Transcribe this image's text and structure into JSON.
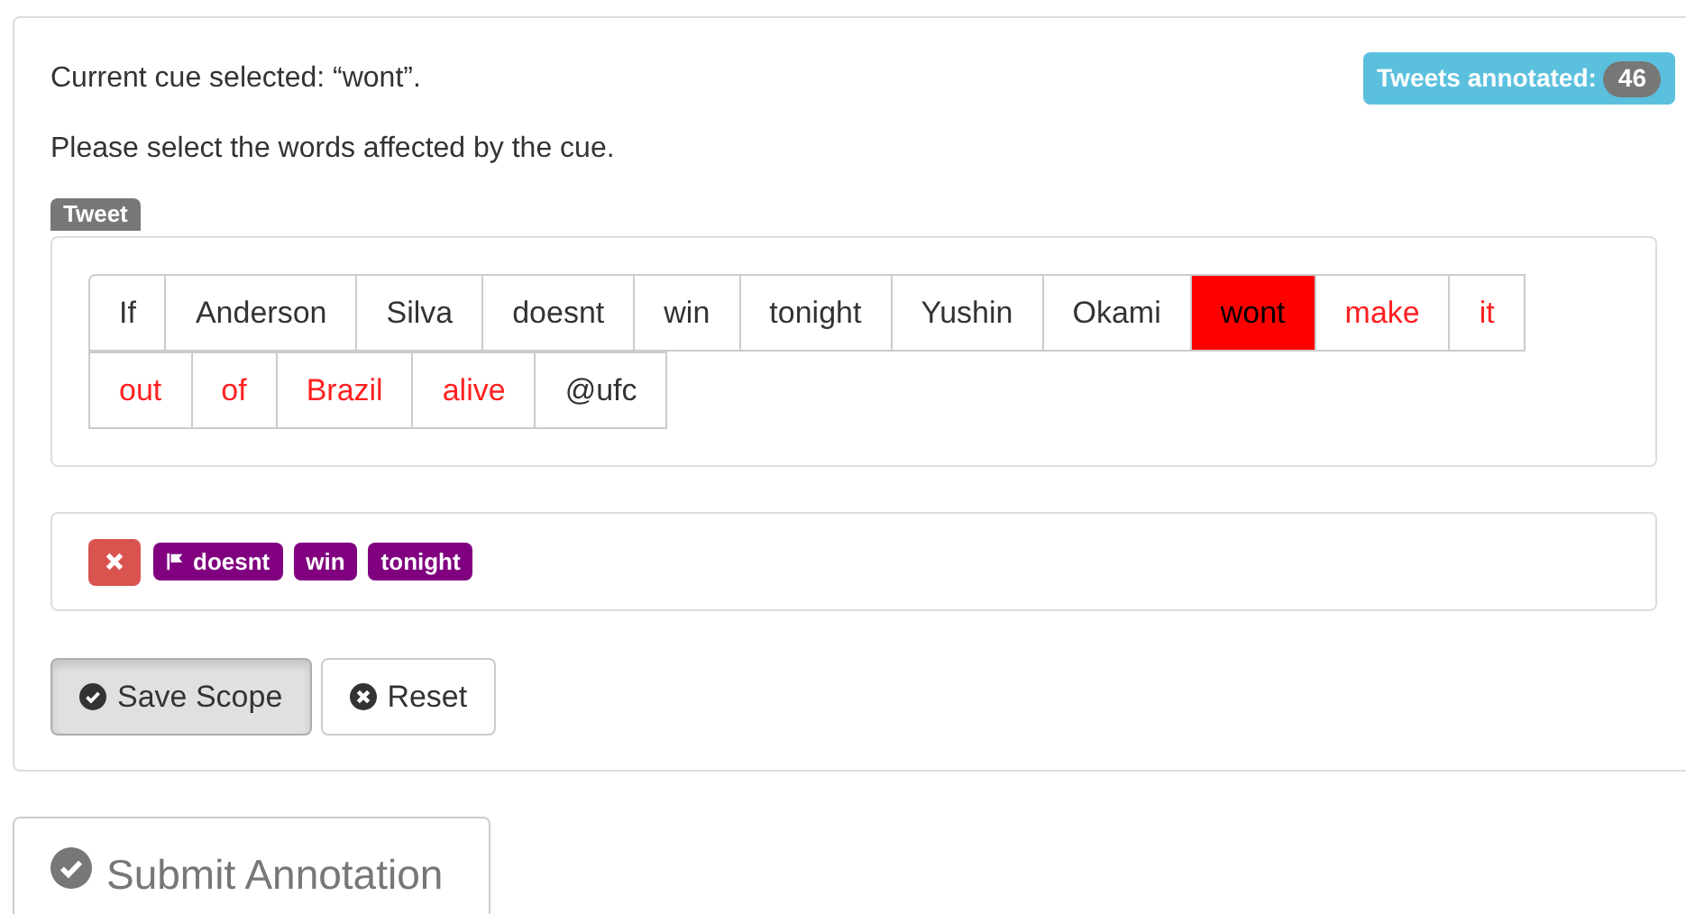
{
  "cue_text": "Current cue selected: “wont”.",
  "badge": {
    "label": "Tweets annotated:",
    "count": "46"
  },
  "instruction": "Please select the words affected by the cue.",
  "tweet_label": "Tweet",
  "word_rows": [
    [
      {
        "text": "If",
        "kind": "plain"
      },
      {
        "text": "Anderson",
        "kind": "plain"
      },
      {
        "text": "Silva",
        "kind": "plain"
      },
      {
        "text": "doesnt",
        "kind": "plain"
      },
      {
        "text": "win",
        "kind": "plain"
      },
      {
        "text": "tonight",
        "kind": "plain"
      },
      {
        "text": "Yushin",
        "kind": "plain"
      },
      {
        "text": "Okami",
        "kind": "plain"
      },
      {
        "text": "wont",
        "kind": "cue"
      },
      {
        "text": "make",
        "kind": "scope"
      },
      {
        "text": "it",
        "kind": "scope"
      }
    ],
    [
      {
        "text": "out",
        "kind": "scope"
      },
      {
        "text": "of",
        "kind": "scope"
      },
      {
        "text": "Brazil",
        "kind": "scope"
      },
      {
        "text": "alive",
        "kind": "scope"
      },
      {
        "text": "@ufc",
        "kind": "plain"
      }
    ]
  ],
  "tags": [
    {
      "text": "doesnt",
      "kind": "flagged"
    },
    {
      "text": "win",
      "kind": "plain"
    },
    {
      "text": "tonight",
      "kind": "plain"
    }
  ],
  "buttons": [
    {
      "label": "Save Scope",
      "pressed": true,
      "kind": "save"
    },
    {
      "label": "Reset",
      "pressed": false,
      "kind": "reset"
    }
  ],
  "submit": "Submit Annotation"
}
